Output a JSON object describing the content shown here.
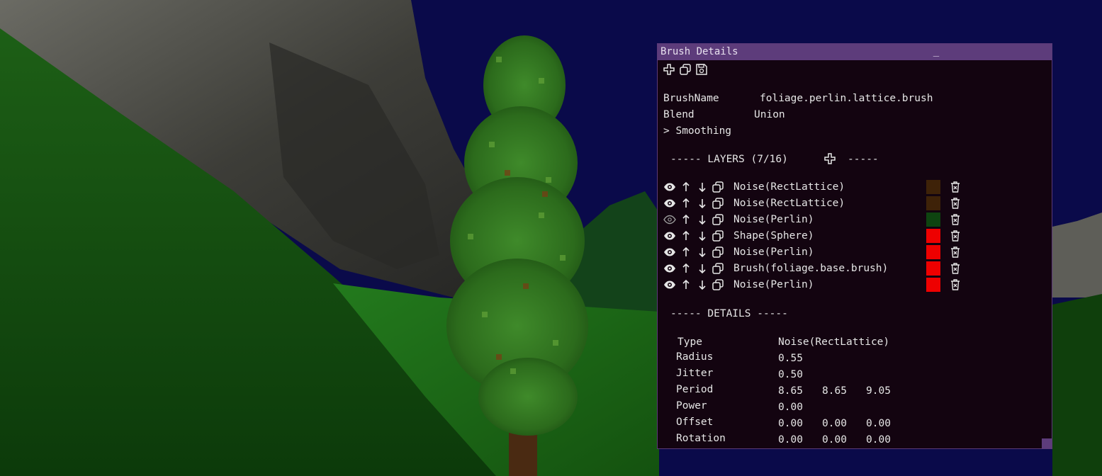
{
  "window": {
    "title": "Brush Details",
    "minimize_label": "_"
  },
  "toolbar": [
    {
      "icon": "add-icon"
    },
    {
      "icon": "copy-icon"
    },
    {
      "icon": "save-icon"
    }
  ],
  "properties": {
    "brush_name_label": "BrushName",
    "brush_name_value": "foliage.perlin.lattice.brush",
    "blend_label": "Blend",
    "blend_value": "Union",
    "smoothing_label": "> Smoothing"
  },
  "layers": {
    "header_left": "----- LAYERS (7/16)",
    "header_right": "-----",
    "items": [
      {
        "name": "Noise(RectLattice)",
        "color": "#3e2208",
        "visible": true
      },
      {
        "name": "Noise(RectLattice)",
        "color": "#3e2208",
        "visible": true
      },
      {
        "name": "Noise(Perlin)",
        "color": "#0e4410",
        "visible": false
      },
      {
        "name": "Shape(Sphere)",
        "color": "#ee0000",
        "visible": true
      },
      {
        "name": "Noise(Perlin)",
        "color": "#ee0000",
        "visible": true
      },
      {
        "name": "Brush(foliage.base.brush)",
        "color": "#ee0000",
        "visible": true
      },
      {
        "name": "Noise(Perlin)",
        "color": "#ee0000",
        "visible": true
      }
    ]
  },
  "details": {
    "header": "----- DETAILS -----",
    "type_label": "Type",
    "type_value": "Noise(RectLattice)",
    "radius_label": "Radius",
    "radius_value": "0.55",
    "jitter_label": "Jitter",
    "jitter_value": "0.50",
    "period_label": "Period",
    "period_values": [
      "8.65",
      "8.65",
      "9.05"
    ],
    "power_label": "Power",
    "power_value": "0.00",
    "offset_label": "Offset",
    "offset_values": [
      "0.00",
      "0.00",
      "0.00"
    ],
    "rotation_label": "Rotation",
    "rotation_values": [
      "0.00",
      "0.00",
      "0.00"
    ]
  },
  "colors": {
    "title_bar": "#5d3c7b",
    "panel_bg": "#130410",
    "text": "#e6e6e6",
    "sky": "#0a0a4a",
    "grass": "#1f6a1a"
  }
}
